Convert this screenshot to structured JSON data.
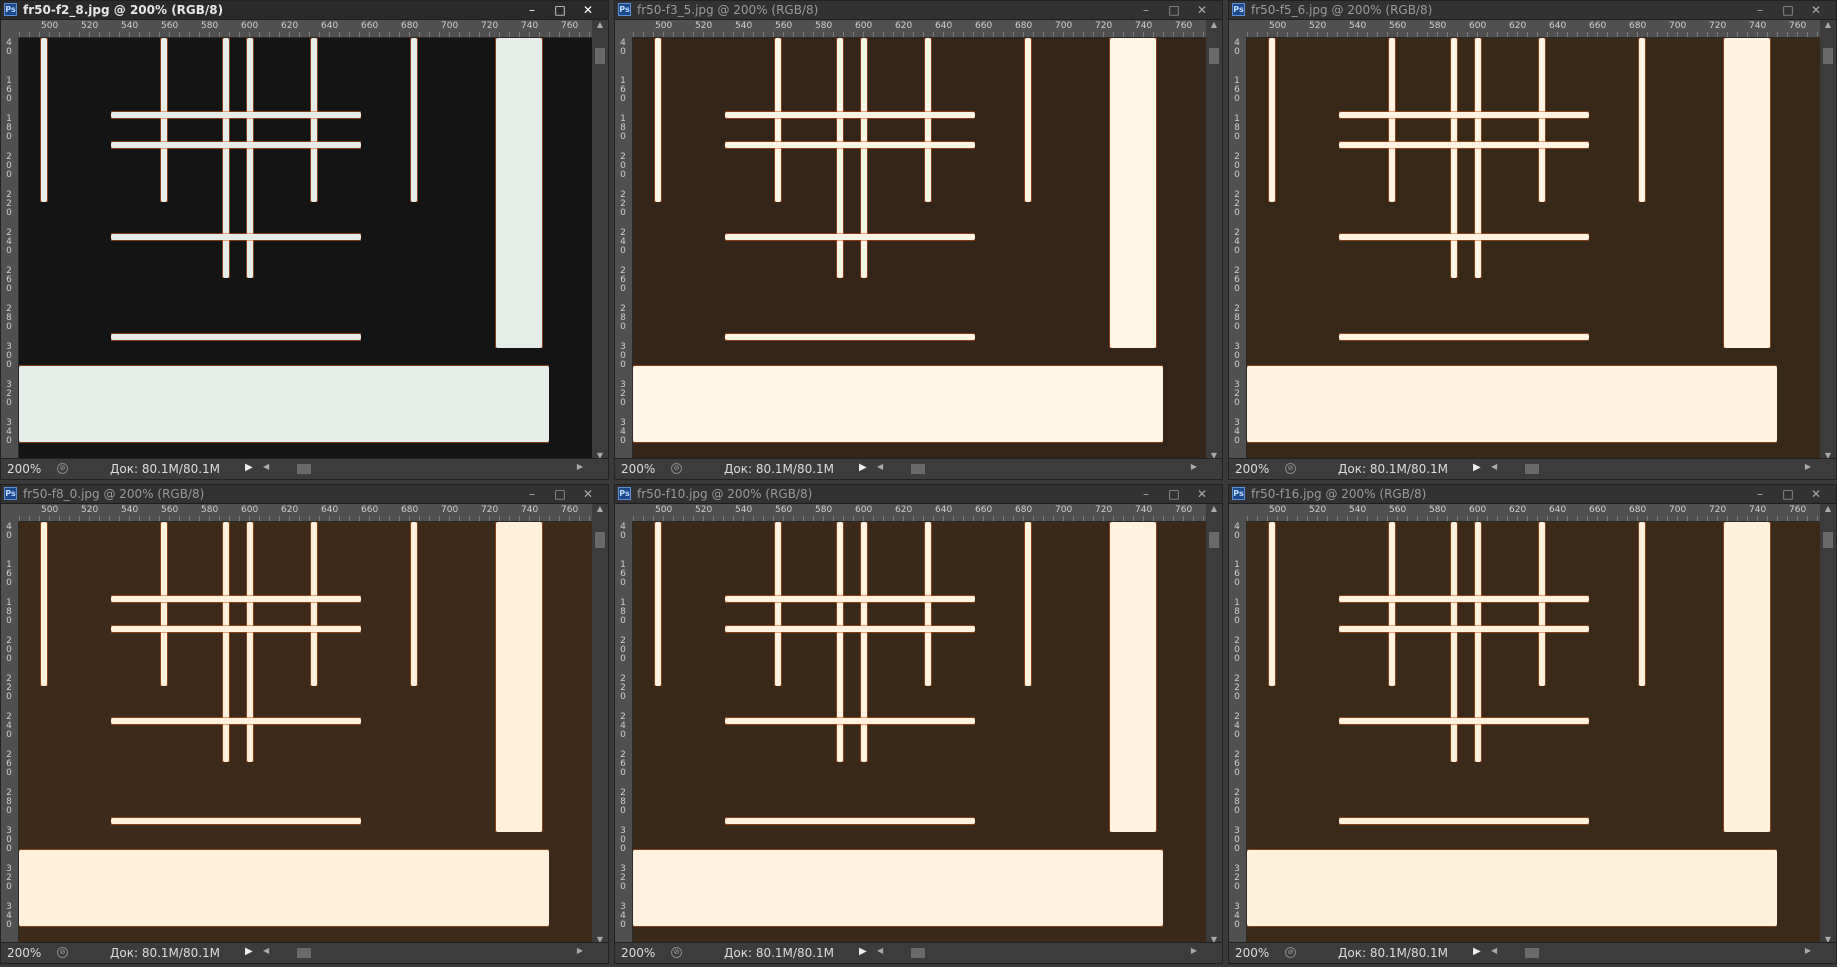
{
  "ruler_top_labels": [
    "500",
    "520",
    "540",
    "560",
    "580",
    "600",
    "620",
    "640",
    "660",
    "680",
    "700",
    "720",
    "740",
    "760"
  ],
  "ruler_left_labels": [
    "4\n0",
    "1\n6\n0",
    "1\n8\n0",
    "2\n0\n0",
    "2\n2\n0",
    "2\n4\n0",
    "2\n6\n0",
    "2\n8\n0",
    "3\n0\n0",
    "3\n2\n0",
    "3\n4\n0"
  ],
  "windows": [
    {
      "title": "fr50-f2_8.jpg @ 200% (RGB/8)",
      "active": true,
      "zoom": "200%",
      "doc": "Док: 80.1M/80.1M",
      "bg": "#141414",
      "fg": "#e6ece8",
      "edge": "#e06020"
    },
    {
      "title": "fr50-f3_5.jpg @ 200% (RGB/8)",
      "active": false,
      "zoom": "200%",
      "doc": "Док: 80.1M/80.1M",
      "bg": "#352418",
      "fg": "#fff6e6",
      "edge": "#d0501c"
    },
    {
      "title": "fr50-f5_6.jpg @ 200% (RGB/8)",
      "active": false,
      "zoom": "200%",
      "doc": "Док: 80.1M/80.1M",
      "bg": "#382818",
      "fg": "#fff4e2",
      "edge": "#c85a20"
    },
    {
      "title": "fr50-f8_0.jpg @ 200% (RGB/8)",
      "active": false,
      "zoom": "200%",
      "doc": "Док: 80.1M/80.1M",
      "bg": "#3e2a18",
      "fg": "#fff1dc",
      "edge": "#c4581e"
    },
    {
      "title": "fr50-f10.jpg @ 200% (RGB/8)",
      "active": false,
      "zoom": "200%",
      "doc": "Док: 80.1M/80.1M",
      "bg": "#3a2818",
      "fg": "#fff3e0",
      "edge": "#c8581e"
    },
    {
      "title": "fr50-f16.jpg @ 200% (RGB/8)",
      "active": false,
      "zoom": "200%",
      "doc": "Док: 80.1M/80.1M",
      "bg": "#3c2a18",
      "fg": "#fff2dc",
      "edge": "#c45a20"
    }
  ],
  "icons": {
    "app": "photoshop-icon",
    "minimize": "minimize-icon",
    "maximize": "maximize-icon",
    "close": "close-icon"
  },
  "app_icon_label": "Ps",
  "win_buttons": {
    "minimize": "–",
    "maximize": "□",
    "close": "✕"
  }
}
